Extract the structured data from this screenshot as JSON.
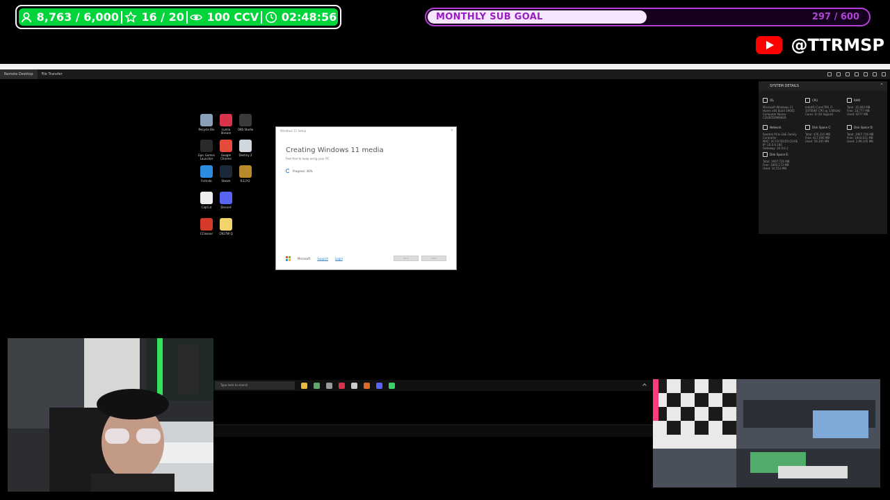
{
  "stats": {
    "followers": "8,763 / 6,000",
    "subs": "16 / 20",
    "ccv": "100 CCV",
    "timer": "02:48:56"
  },
  "goal": {
    "label": "MONTHLY SUB GOAL",
    "count": "297 / 600",
    "progress": 0.495
  },
  "youtube": {
    "handle": "@TTRMSP"
  },
  "remote": {
    "tabs": [
      "Remote Desktop",
      "File Transfer"
    ]
  },
  "desktop_icons": [
    {
      "label": "Recycle Bin",
      "icon": "recycle-bin-icon",
      "color": "#8aa0b8"
    },
    {
      "label": "Lumia Stream",
      "icon": "lumia-icon",
      "color": "#d8334a"
    },
    {
      "label": "OBS Studio",
      "icon": "obs-icon",
      "color": "#3a3a3a"
    },
    {
      "label": "Epic Games Launcher",
      "icon": "epic-icon",
      "color": "#2a2a2a"
    },
    {
      "label": "Google Chrome",
      "icon": "chrome-icon",
      "color": "#e44b3a"
    },
    {
      "label": "Destiny 2",
      "icon": "destiny-icon",
      "color": "#cfd6de"
    },
    {
      "label": "Fortnite",
      "icon": "fortnite-icon",
      "color": "#2c8de0"
    },
    {
      "label": "Steam",
      "icon": "steam-icon",
      "color": "#1b2838"
    },
    {
      "label": "R.E.P.O.",
      "icon": "repo-icon",
      "color": "#b98a2a"
    },
    {
      "label": "CapCut",
      "icon": "capcut-icon",
      "color": "#eeeeee"
    },
    {
      "label": "Discord",
      "icon": "discord-icon",
      "color": "#5865f2"
    },
    {
      "label": "CCleaner",
      "icon": "ccleaner-icon",
      "color": "#d33a2a"
    },
    {
      "label": "CN37W Q",
      "icon": "file-icon",
      "color": "#f3d46a"
    }
  ],
  "setup": {
    "window_title": "Windows 11 Setup",
    "heading": "Creating Windows 11 media",
    "subtitle": "Feel free to keep using your PC.",
    "progress_text": "Progress: 36%",
    "footer_brand": "Microsoft",
    "footer_links": [
      "Support",
      "Legal"
    ],
    "buttons": [
      "Back",
      "Next"
    ]
  },
  "system_details": {
    "title": "SYSTEM DETAILS",
    "cells": [
      {
        "label": "OS",
        "lines": [
          "Microsoft Windows 11",
          "Home x64 Build 19045",
          "Computer Name:",
          "COUNTERMAKER"
        ]
      },
      {
        "label": "CPU",
        "lines": [
          "Intel(R) Core(TM) i7-",
          "10700KF CPU @ 3.80GHz",
          "Cores: 8 (16 logical)"
        ]
      },
      {
        "label": "RAM",
        "lines": [
          "Total: 32,693 MB",
          "Free: 18,777 MB",
          "Used: 4277 MB"
        ]
      },
      {
        "label": "Network",
        "lines": [
          "Realtek PCIe GbE Family",
          "Controller",
          "MAC: 2C:F0:5D:D5:C0:0E",
          "IP: 10.0.0.184",
          "Gateway: 10.0.0.1"
        ]
      },
      {
        "label": "Disk Space C:",
        "lines": [
          "Total: 476,310 MB",
          "Free: 417,006 MB",
          "Used: 59,305 MB"
        ]
      },
      {
        "label": "Disk Space D:",
        "lines": [
          "Total: 1907,726 MB",
          "Free: 1604,621 MB",
          "Used: 2,99,105 MB"
        ]
      },
      {
        "label": "Disk Space E:",
        "lines": [
          "Total: 1907,726 MB",
          "Free: 1893,173 MB",
          "Used: 14,553 MB"
        ]
      }
    ]
  },
  "taskbar": {
    "search_placeholder": "Type here to search",
    "icons": [
      {
        "name": "file-explorer-icon",
        "color": "#e8b93c"
      },
      {
        "name": "chrome-taskbar-icon",
        "color": "#5fa86a"
      },
      {
        "name": "obs-taskbar-icon",
        "color": "#9a9a9a"
      },
      {
        "name": "lumia-taskbar-icon",
        "color": "#d8334a"
      },
      {
        "name": "settings-taskbar-icon",
        "color": "#cccccc"
      },
      {
        "name": "repo-taskbar-icon",
        "color": "#d96a2a"
      },
      {
        "name": "discord-taskbar-icon",
        "color": "#5865f2"
      },
      {
        "name": "monitor-taskbar-icon",
        "color": "#3ad06a"
      }
    ]
  }
}
